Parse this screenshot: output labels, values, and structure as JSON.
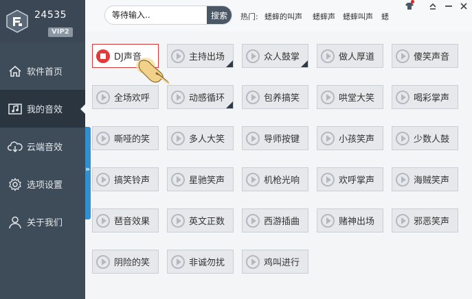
{
  "app": {
    "user_id": "24535",
    "vip_label": "VIP2"
  },
  "sidebar": {
    "items": [
      {
        "label": "软件首页",
        "icon": "home-icon"
      },
      {
        "label": "我的音效",
        "icon": "music-note-icon",
        "active": true
      },
      {
        "label": "云端音效",
        "icon": "cloud-download-icon"
      },
      {
        "label": "选项设置",
        "icon": "gear-icon"
      },
      {
        "label": "关于我们",
        "icon": "user-icon"
      }
    ],
    "collapse_glyph": "»"
  },
  "search": {
    "placeholder": "等待输入..",
    "button_label": "搜索"
  },
  "hot": {
    "label": "热门:",
    "links": [
      "蟋蟀的叫声",
      "蟋蟀声",
      "蟋蟀叫声",
      "蟋"
    ]
  },
  "window_controls": [
    "skin-icon",
    "minimize-icon",
    "maximize-icon",
    "close-icon"
  ],
  "colors": {
    "sidebar_bg": "#3e4b59",
    "active_bg": "#2b3540",
    "accent_blue": "#2f8fd0",
    "playing_red": "#e03a3a"
  },
  "sounds": [
    {
      "label": "DJ声音",
      "playing": true,
      "corner": false
    },
    {
      "label": "主持出场",
      "corner": true
    },
    {
      "label": "众人鼓掌",
      "corner": true
    },
    {
      "label": "做人厚道",
      "corner": false
    },
    {
      "label": "傻笑声音",
      "corner": false
    },
    {
      "label": "全场欢呼",
      "corner": false
    },
    {
      "label": "动感循环",
      "corner": true
    },
    {
      "label": "包养搞笑",
      "corner": false
    },
    {
      "label": "哄堂大笑",
      "corner": false
    },
    {
      "label": "喝彩掌声",
      "corner": false
    },
    {
      "label": "嘶哑的笑",
      "corner": false
    },
    {
      "label": "多人大笑",
      "corner": false
    },
    {
      "label": "导师按键",
      "corner": false
    },
    {
      "label": "小孩笑声",
      "corner": false
    },
    {
      "label": "少数人鼓",
      "corner": false
    },
    {
      "label": "搞笑铃声",
      "corner": false
    },
    {
      "label": "星驰笑声",
      "corner": false
    },
    {
      "label": "机枪光响",
      "corner": false
    },
    {
      "label": "欢呼掌声",
      "corner": false
    },
    {
      "label": "海贼笑声",
      "corner": false
    },
    {
      "label": "琶音效果",
      "corner": false
    },
    {
      "label": "英文正数",
      "corner": false
    },
    {
      "label": "西游插曲",
      "corner": false
    },
    {
      "label": "赌神出场",
      "corner": false
    },
    {
      "label": "邪恶笑声",
      "corner": false
    },
    {
      "label": "阴险的笑",
      "corner": false
    },
    {
      "label": "非诚勿扰",
      "corner": false
    },
    {
      "label": "鸡叫进行",
      "corner": false
    }
  ]
}
